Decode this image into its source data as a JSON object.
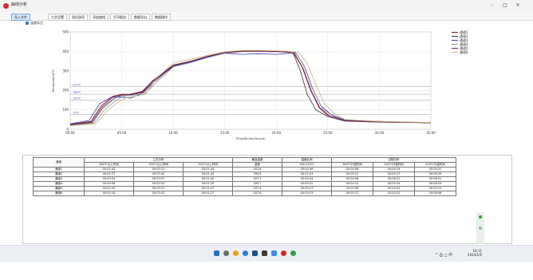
{
  "window": {
    "title": "曲线分析",
    "minimize": "–",
    "maximize": "□",
    "close": "×"
  },
  "menu": [
    {
      "label": "导入文件",
      "active": true
    },
    {
      "label": "工艺设置",
      "active": false
    },
    {
      "label": "测试选项",
      "active": false
    },
    {
      "label": "添加曲线",
      "active": false
    },
    {
      "label": "打印报告",
      "active": false
    },
    {
      "label": "数据导出",
      "active": false
    },
    {
      "label": "数据操作",
      "active": false
    }
  ],
  "subtoolbar": {
    "label": "温度标注"
  },
  "chart_data": {
    "type": "line",
    "title": "",
    "xlabel": "Time(Minute:Second)",
    "ylabel": "Temperature(℃)",
    "xlim": [
      0,
      2100
    ],
    "ylim": [
      0,
      500
    ],
    "x_tick_labels": [
      "00:00",
      "05:00",
      "10:00",
      "15:00",
      "20:00",
      "25:00",
      "30:00",
      "35:00"
    ],
    "x_tick_values": [
      0,
      300,
      600,
      900,
      1200,
      1500,
      1800,
      2100
    ],
    "y_tick_values": [
      0,
      100,
      200,
      300,
      400,
      500
    ],
    "grid": true,
    "legend_position": "top-right",
    "reference_lines": [
      {
        "label": "220℃",
        "y": 220
      },
      {
        "label": "180℃",
        "y": 180
      },
      {
        "label": "150℃",
        "y": 150
      },
      {
        "label": "75℃",
        "y": 75
      }
    ],
    "series": [
      {
        "name": "通道1",
        "color": "#8b1a1a",
        "x": [
          0,
          120,
          180,
          250,
          300,
          350,
          420,
          480,
          600,
          700,
          800,
          900,
          1000,
          1100,
          1200,
          1260,
          1300,
          1350,
          1400,
          1450,
          1500,
          1600,
          1800,
          2000,
          2100
        ],
        "y": [
          25,
          40,
          120,
          170,
          180,
          180,
          195,
          250,
          330,
          350,
          375,
          395,
          402,
          402,
          400,
          398,
          392,
          320,
          200,
          110,
          70,
          45,
          38,
          35,
          33
        ]
      },
      {
        "name": "通道2",
        "color": "#333333",
        "x": [
          0,
          130,
          190,
          260,
          300,
          360,
          430,
          490,
          600,
          700,
          800,
          900,
          1000,
          1100,
          1200,
          1260,
          1300,
          1340,
          1380,
          1430,
          1500,
          1600,
          1800,
          2000,
          2100
        ],
        "y": [
          22,
          35,
          110,
          160,
          175,
          178,
          190,
          245,
          325,
          348,
          372,
          392,
          400,
          400,
          398,
          396,
          388,
          300,
          180,
          100,
          65,
          42,
          36,
          34,
          32
        ]
      },
      {
        "name": "通道3",
        "color": "#3b3bb8",
        "x": [
          0,
          110,
          170,
          240,
          300,
          350,
          410,
          470,
          600,
          700,
          800,
          900,
          1000,
          1100,
          1200,
          1270,
          1310,
          1360,
          1410,
          1460,
          1520,
          1600,
          1800,
          2000,
          2100
        ],
        "y": [
          28,
          45,
          130,
          165,
          165,
          160,
          180,
          240,
          320,
          345,
          370,
          390,
          385,
          388,
          385,
          390,
          395,
          330,
          210,
          120,
          75,
          48,
          40,
          36,
          34
        ]
      },
      {
        "name": "通道4",
        "color": "#8f8fa0",
        "x": [
          0,
          140,
          200,
          270,
          310,
          370,
          440,
          500,
          600,
          700,
          800,
          900,
          1000,
          1100,
          1200,
          1270,
          1320,
          1370,
          1420,
          1470,
          1530,
          1600,
          1800,
          2000,
          2100
        ],
        "y": [
          20,
          32,
          100,
          150,
          170,
          175,
          185,
          240,
          320,
          342,
          368,
          390,
          398,
          399,
          397,
          395,
          386,
          310,
          190,
          105,
          68,
          44,
          37,
          35,
          33
        ]
      },
      {
        "name": "通道5",
        "color": "#7a1f55",
        "x": [
          0,
          125,
          185,
          255,
          305,
          355,
          425,
          485,
          600,
          700,
          800,
          900,
          1000,
          1100,
          1200,
          1265,
          1305,
          1355,
          1405,
          1455,
          1510,
          1600,
          1800,
          2000,
          2100
        ],
        "y": [
          24,
          38,
          115,
          168,
          178,
          179,
          192,
          248,
          328,
          349,
          374,
          394,
          401,
          401,
          399,
          397,
          390,
          315,
          195,
          108,
          69,
          44,
          38,
          35,
          33
        ]
      },
      {
        "name": "通道6",
        "color": "#c9b77a",
        "x": [
          0,
          150,
          210,
          280,
          320,
          380,
          440,
          500,
          600,
          700,
          800,
          900,
          1000,
          1100,
          1200,
          1280,
          1330,
          1380,
          1430,
          1480,
          1540,
          1600,
          1800,
          2000,
          2100
        ],
        "y": [
          18,
          28,
          90,
          140,
          160,
          170,
          180,
          260,
          340,
          360,
          380,
          398,
          405,
          405,
          403,
          400,
          395,
          340,
          230,
          130,
          80,
          50,
          40,
          36,
          34
        ]
      }
    ]
  },
  "result_tabs": [
    {
      "label": "曲线分析",
      "active": true
    },
    {
      "label": "详细数据",
      "active": false
    }
  ],
  "table": {
    "group_headers": [
      "通道",
      "工艺分析",
      "最高温度",
      "温度区间",
      "过程分析"
    ],
    "sub_headers": [
      "180℃以上时间",
      "150℃以上时间",
      "220℃以上时间",
      "温度",
      "180-220℃",
      "180℃升温时间",
      "150℃升温时间",
      "220℃升温时间"
    ],
    "rows": [
      [
        "通道1",
        "00:02:42",
        "00:03:12",
        "00:01:44",
        "401.6",
        "00:00:36",
        "00:04:06",
        "00:04:29",
        "00:05:52"
      ],
      [
        "通道2",
        "00:02:37",
        "00:03:40",
        "00:01:29",
        "399.6",
        "00:01:03",
        "00:05:12",
        "00:05:27",
        "00:06:39"
      ],
      [
        "通道3",
        "00:03:04",
        "00:03:57",
        "00:01:40",
        "407.2",
        "00:00:04",
        "00:04:56",
        "00:06:22",
        "00:06:51"
      ],
      [
        "通道4",
        "00:00:56",
        "00:03:53",
        "00:01:29",
        "409.7",
        "00:00:22",
        "00:04:14",
        "00:05:54",
        "00:06:59"
      ],
      [
        "通道5",
        "00:02:25",
        "00:03:57",
        "00:01:47",
        "407.9",
        "00:00:27",
        "00:03:36",
        "00:04:03",
        "00:05:22"
      ],
      [
        "通道6",
        "00:02:44",
        "00:03:03",
        "00:01:27",
        "407.6",
        "00:00:23",
        "00:05:37",
        "00:05:22",
        "00:06:06"
      ]
    ]
  },
  "tray": {
    "time": "16:11",
    "date": "2024/1/6",
    "lang": "中"
  }
}
